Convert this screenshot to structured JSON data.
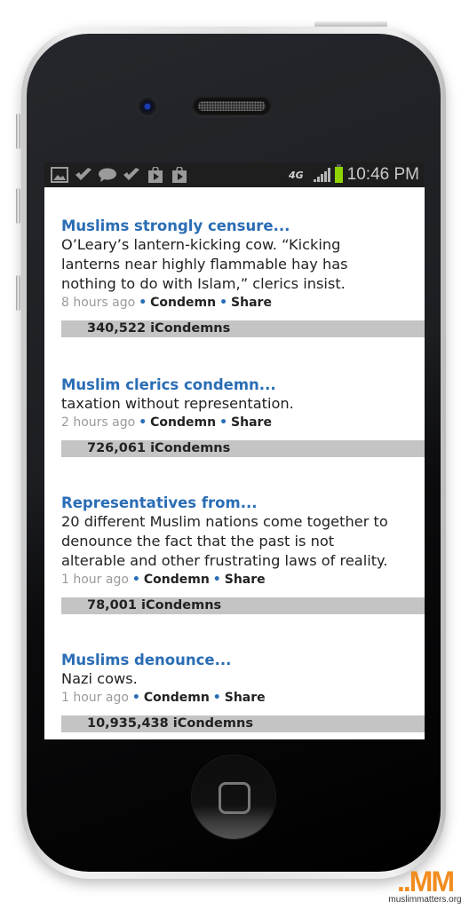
{
  "status_bar": {
    "icons": [
      "gallery-icon",
      "check-icon",
      "chat-icon",
      "check-icon",
      "store-icon",
      "store-icon"
    ],
    "network": "4G",
    "time": "10:46 PM",
    "battery_color": "#8fd400"
  },
  "feed": {
    "accent_color": "#2a6db5",
    "items": [
      {
        "title": "Muslims strongly censure...",
        "body_lines": [
          "O’Leary’s lantern-kicking cow. “Kicking",
          "lanterns near highly flammable hay has",
          "nothing to do with Islam,” clerics insist."
        ],
        "time": "8 hours ago",
        "condemn": "Condemn",
        "share": "Share",
        "count": "340,522 iCondemns"
      },
      {
        "title": "Muslim clerics condemn...",
        "body_lines": [
          "taxation without representation."
        ],
        "time": "2 hours ago",
        "condemn": "Condemn",
        "share": "Share",
        "count": "726,061 iCondemns"
      },
      {
        "title": "Representatives from...",
        "body_lines": [
          "20 different Muslim nations come together to",
          "denounce the fact that the past is not",
          "alterable and other frustrating laws of reality."
        ],
        "time": "1 hour ago",
        "condemn": "Condemn",
        "share": "Share",
        "count": "78,001 iCondemns"
      },
      {
        "title": "Muslims denounce...",
        "body_lines": [
          "Nazi cows."
        ],
        "time": "1 hour ago",
        "condemn": "Condemn",
        "share": "Share",
        "count": "10,935,438 iCondemns"
      }
    ]
  },
  "logo": {
    "mark": "..MM",
    "url": "muslimmatters.org",
    "color": "#f28c1e"
  }
}
